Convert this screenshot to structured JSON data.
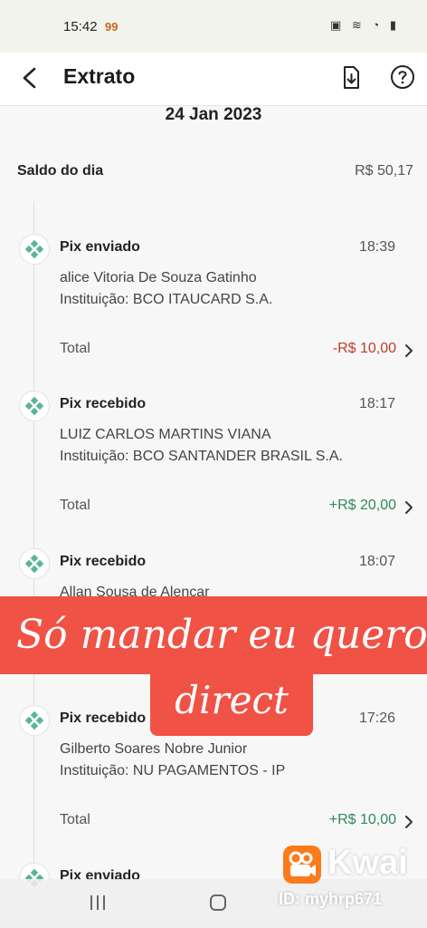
{
  "status_bar": {
    "time": "15:42",
    "notif_text": "99",
    "right_icons": "▣ ≋ ◔ ▮"
  },
  "header": {
    "title": "Extrato",
    "back_icon": "arrow-left-icon",
    "download_icon": "download-icon",
    "help_icon": "help-icon"
  },
  "date": "24 Jan 2023",
  "saldo": {
    "label": "Saldo do dia",
    "value": "R$ 50,17"
  },
  "transactions": [
    {
      "type": "Pix enviado",
      "time": "18:39",
      "name": "alice Vitoria De Souza Gatinho",
      "institution": "Instituição: BCO ITAUCARD S.A.",
      "total_label": "Total",
      "total_value": "-R$ 10,00"
    },
    {
      "type": "Pix recebido",
      "time": "18:17",
      "name": "LUIZ CARLOS MARTINS VIANA",
      "institution": "Instituição: BCO SANTANDER  BRASIL  S.A.",
      "total_label": "Total",
      "total_value": "+R$ 20,00"
    },
    {
      "type": "Pix recebido",
      "time": "18:07",
      "name": "Allan Sousa de Alencar"
    },
    {
      "type": "Pix recebido",
      "time": "17:26",
      "name": "Gilberto Soares Nobre Junior",
      "institution": "Instituição: NU PAGAMENTOS - IP",
      "total_label": "Total",
      "total_value": "+R$ 10,00"
    },
    {
      "type": "Pix enviado"
    }
  ],
  "overlay": {
    "line1": "Só mandar eu quero n",
    "line2": "direct"
  },
  "watermark": {
    "brand": "Kwai",
    "id": "ID: myhrp671"
  },
  "colors": {
    "negative": "#c43a2c",
    "positive": "#2e8a5e",
    "pix_icon": "#5bb592",
    "overlay_bg": "#f05246"
  }
}
